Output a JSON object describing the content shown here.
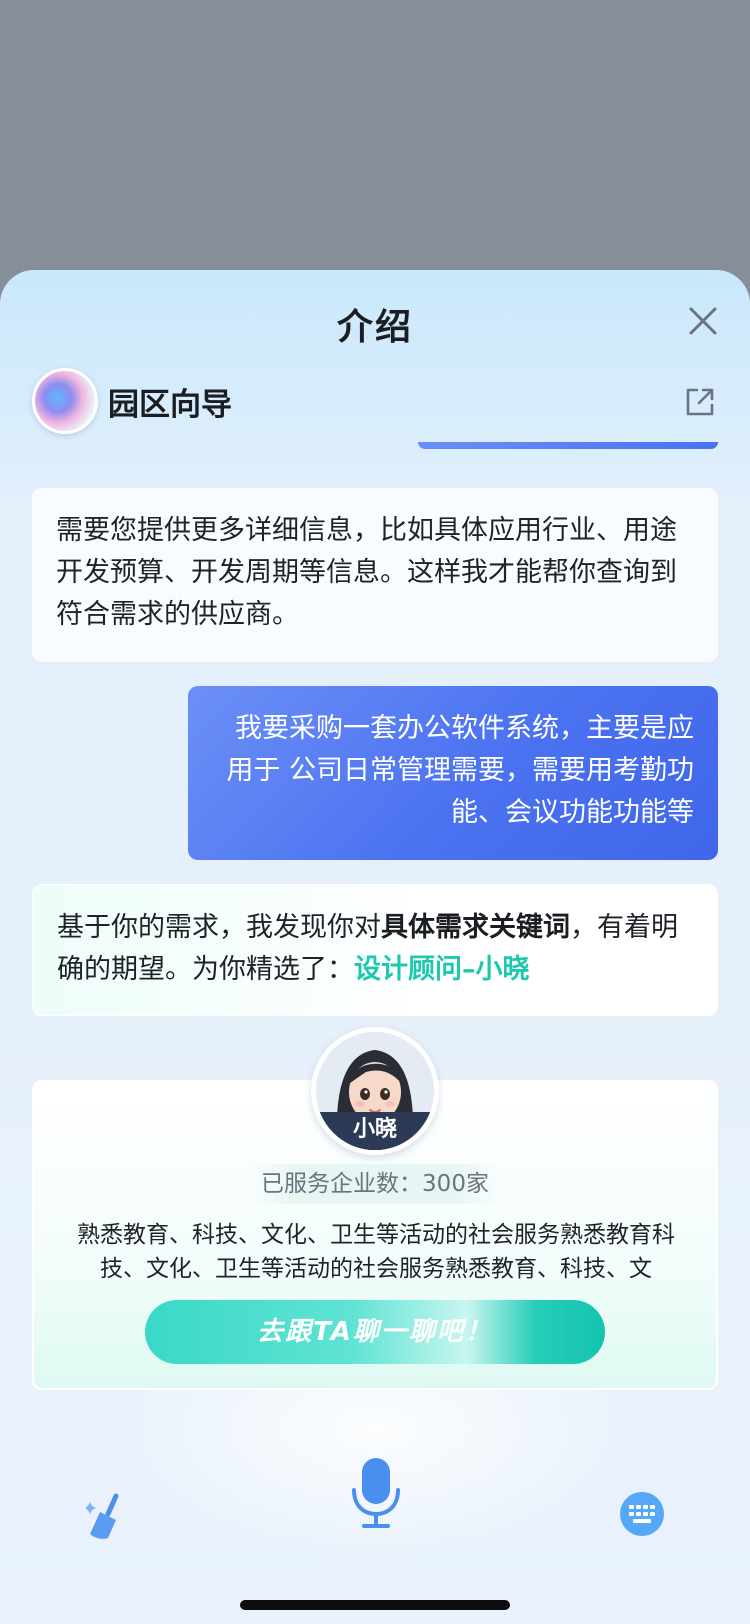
{
  "sheet": {
    "title": "介绍",
    "close_icon": "close-icon",
    "share_icon": "external-share-icon"
  },
  "agent": {
    "name": "园区向导"
  },
  "messages": {
    "bot_1": "需要您提供更多详细信息，比如具体应用行业、用途开发预算、开发周期等信息。这样我才能帮你查询到符合需求的供应商。",
    "user_1": "我要采购一套办公软件系统，主要是应用于 公司日常管理需要，需要用考勤功能、会议功能功能等",
    "bot_2": {
      "prefix": "基于你的需求，我发现你对",
      "keyword": "具体需求关键词",
      "middle": "，有着明确的期望。为你精选了：",
      "link": "设计顾问–小晓"
    }
  },
  "advisor": {
    "name": "小晓",
    "served": "已服务企业数：300家",
    "description": "熟悉教育、科技、文化、卫生等活动的社会服务熟悉教育科技、文化、卫生等活动的社会服务熟悉教育、科技、文",
    "cta_label": "去跟TA聊一聊吧！"
  },
  "toolbar": {
    "clear_icon": "broom-icon",
    "voice_icon": "microphone-icon",
    "keyboard_icon": "keyboard-icon"
  },
  "colors": {
    "user_bubble": "#4b72f0",
    "accent_teal": "#1cc9ae",
    "mic_blue": "#4a8ff0"
  }
}
